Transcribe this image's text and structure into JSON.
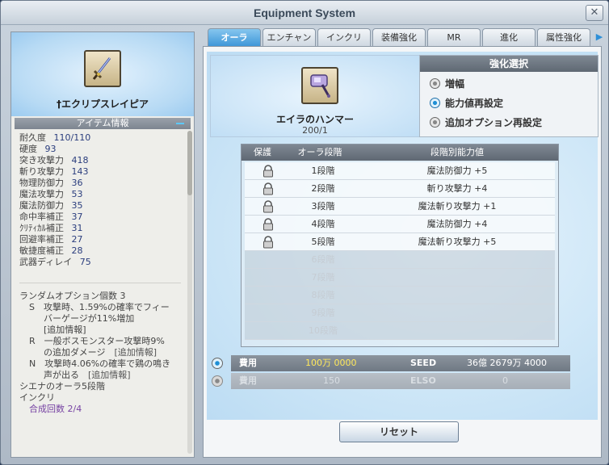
{
  "window": {
    "title": "Equipment System",
    "close_label": "✕"
  },
  "item": {
    "name": "†エクリプスレイピア",
    "section_title": "アイテム情報",
    "stats": [
      {
        "label": "耐久度",
        "value": "110/110"
      },
      {
        "label": "硬度",
        "value": "93"
      },
      {
        "label": "突き攻撃力",
        "value": "418"
      },
      {
        "label": "斬り攻撃力",
        "value": "143"
      },
      {
        "label": "物理防御力",
        "value": "36"
      },
      {
        "label": "魔法攻撃力",
        "value": "53"
      },
      {
        "label": "魔法防御力",
        "value": "35"
      },
      {
        "label": "命中率補正",
        "value": "37"
      },
      {
        "label": "ｸﾘﾃｨｶﾙ補正",
        "value": "31"
      },
      {
        "label": "回避率補正",
        "value": "27"
      },
      {
        "label": "敏捷度補正",
        "value": "28"
      },
      {
        "label": "武器ディレイ",
        "value": "75"
      }
    ],
    "options": {
      "count_line": "ランダムオプション個数 3",
      "s_line1": "S　攻撃時、1.59%の確率でフィー",
      "s_line2": "バーゲージが11%増加",
      "s_info": "[追加情報]",
      "r_line1": "R　一般ボスモンスター攻撃時9%",
      "r_line2": "の追加ダメージ",
      "r_info": "[追加情報]",
      "n_line1": "N　攻撃時4.06%の確率で鶏の鳴き",
      "n_line2": "声が出る",
      "n_info": "[追加情報]",
      "aura_line": "シエナのオーラ5段階",
      "inkuri_line": "インクリ",
      "synth_line": "合成回数 2/4"
    }
  },
  "tabs": [
    {
      "label": "オーラ",
      "active": true
    },
    {
      "label": "エンチャント",
      "active": false
    },
    {
      "label": "インクリ",
      "active": false
    },
    {
      "label": "装備強化",
      "active": false
    },
    {
      "label": "MR",
      "active": false
    },
    {
      "label": "進化",
      "active": false
    },
    {
      "label": "属性強化",
      "active": false
    }
  ],
  "tab_more_icon": "chevron-right-icon",
  "weapon": {
    "name": "エイラのハンマー",
    "count": "200/1"
  },
  "enhance": {
    "title": "強化選択",
    "options": [
      {
        "label": "増幅",
        "selected": false
      },
      {
        "label": "能力値再設定",
        "selected": true
      },
      {
        "label": "追加オプション再設定",
        "selected": false
      }
    ]
  },
  "aura_table": {
    "headers": {
      "protect": "保護",
      "stage": "オーラ段階",
      "value": "段階別能力値"
    },
    "rows": [
      {
        "stage": "1段階",
        "value": "魔法防御力 +5",
        "locked": true
      },
      {
        "stage": "2段階",
        "value": "斬り攻撃力 +4",
        "locked": true
      },
      {
        "stage": "3段階",
        "value": "魔法斬り攻撃力 +1",
        "locked": true
      },
      {
        "stage": "4段階",
        "value": "魔法防御力 +4",
        "locked": true
      },
      {
        "stage": "5段階",
        "value": "魔法斬り攻撃力 +5",
        "locked": true
      },
      {
        "stage": "6段階",
        "value": "",
        "locked": false
      },
      {
        "stage": "7段階",
        "value": "",
        "locked": false
      },
      {
        "stage": "8段階",
        "value": "",
        "locked": false
      },
      {
        "stage": "9段階",
        "value": "",
        "locked": false
      },
      {
        "stage": "10段階",
        "value": "",
        "locked": false
      }
    ]
  },
  "costs": [
    {
      "label": "費用",
      "value": "100万 0000",
      "currency": "SEED",
      "balance": "36億 2679万 4000",
      "selected": true
    },
    {
      "label": "費用",
      "value": "150",
      "currency": "ELSO",
      "balance": "0",
      "selected": false
    }
  ],
  "reset_label": "リセット",
  "colors": {
    "accent": "#3f97d8",
    "cost_yellow": "#ffe85a",
    "option_purple": "#7743a3"
  }
}
